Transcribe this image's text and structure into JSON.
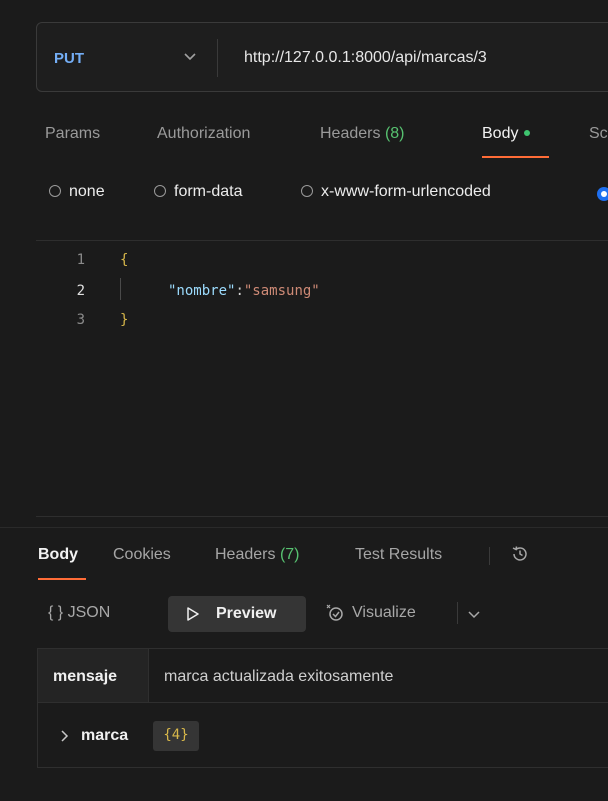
{
  "request": {
    "method": "PUT",
    "url": "http://127.0.0.1:8000/api/marcas/3"
  },
  "request_tabs": {
    "params": "Params",
    "authorization": "Authorization",
    "headers_label": "Headers",
    "headers_count": "(8)",
    "body": "Body",
    "scripts_partial": "Sc"
  },
  "body_types": {
    "none": "none",
    "form_data": "form-data",
    "urlencoded": "x-www-form-urlencoded"
  },
  "editor": {
    "line_numbers": [
      "1",
      "2",
      "3"
    ],
    "open_brace": "{",
    "key": "\"nombre\"",
    "colon": ":",
    "value": "\"samsung\"",
    "close_brace": "}"
  },
  "response_tabs": {
    "body": "Body",
    "cookies": "Cookies",
    "headers_label": "Headers",
    "headers_count": "(7)",
    "test_results": "Test Results"
  },
  "response_format": {
    "json": "{ } JSON",
    "preview": "Preview",
    "visualize": "Visualize"
  },
  "preview_table": {
    "row1_key": "mensaje",
    "row1_value": "marca actualizada exitosamente",
    "row2_key": "marca",
    "row2_count": "{4}"
  },
  "colors": {
    "method": "#74aef6",
    "accent": "#ff6c37",
    "green": "#57c170",
    "raw_radio": "#1e6ff0"
  },
  "icons": [
    "chevron-down-icon",
    "history-icon",
    "play-icon",
    "visualize-icon",
    "chevron-right-icon"
  ]
}
